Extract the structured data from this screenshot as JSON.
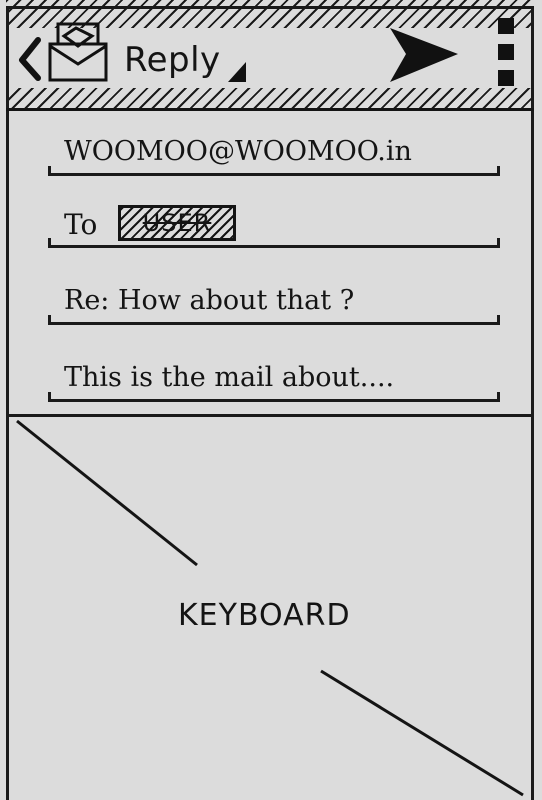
{
  "header": {
    "title": "Reply",
    "back_icon": "chevron-left-icon",
    "mail_icon": "envelope-open-icon",
    "dropdown_icon": "caret-down-icon",
    "send_icon": "send-icon",
    "menu_icon": "more-vertical-icon"
  },
  "compose": {
    "from": "WOOMOO@WOOMOO.in",
    "to_label": "To",
    "to_recipient": "USER",
    "subject": "Re: How about that ?",
    "body": "This is the mail about...."
  },
  "keyboard": {
    "label": "KEYBOARD"
  }
}
